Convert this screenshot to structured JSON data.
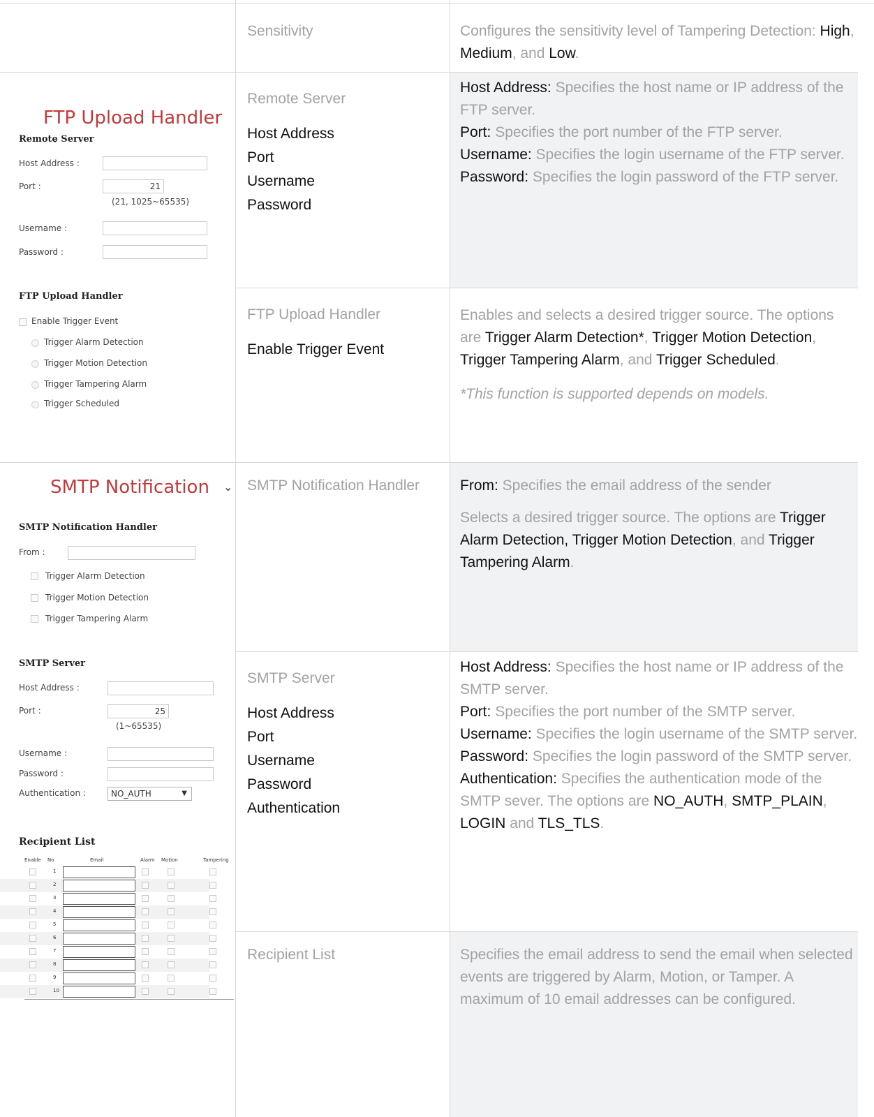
{
  "sensitivity": {
    "name": "Sensitivity",
    "desc_prefix": "Configures the sensitivity level of Tampering Detection: ",
    "high": "High",
    "sep1": ", ",
    "medium": "Medium",
    "sep2": ", and ",
    "low": "Low",
    "end": "."
  },
  "ftp_shot": {
    "header": "FTP Upload Handler",
    "chevron": "⌄",
    "remote_server_title": "Remote Server",
    "host_label": "Host Address :",
    "host_value": "",
    "port_label": "Port :",
    "port_value": "21",
    "port_hint": "(21, 1025~65535)",
    "username_label": "Username :",
    "password_label": "Password :",
    "handler_title": "FTP Upload Handler",
    "enable_trigger": "Enable Trigger Event",
    "options": [
      "Trigger Alarm Detection",
      "Trigger Motion Detection",
      "Trigger Tampering Alarm",
      "Trigger Scheduled"
    ]
  },
  "remote_server": {
    "category": "Remote Server",
    "fields": [
      "Host Address",
      "Port",
      "Username",
      "Password"
    ],
    "host_k": "Host Address:",
    "host_d": " Specifies the host name or IP address of the FTP server.",
    "port_k": "Port:",
    "port_d": " Specifies the port number of the FTP server.",
    "user_k": "Username:",
    "user_d": " Specifies the login username of the FTP server.",
    "pass_k": "Password:",
    "pass_d": " Specifies the login password of the FTP server."
  },
  "ftp_handler": {
    "category": "FTP Upload Handler",
    "field": "Enable Trigger Event",
    "d1": "Enables and selects a desired trigger source. The options are ",
    "o1": "Trigger Alarm Detection*",
    "s1": ", ",
    "o2": "Trigger Motion Detection",
    "s2": ", ",
    "o3": "Trigger Tampering Alarm",
    "s3": ", and ",
    "o4": "Trigger Scheduled",
    "s4": ".",
    "note": "*This function is supported depends on models."
  },
  "smtp_shot": {
    "header": "SMTP Notification",
    "chevron": "⌄",
    "handler_title": "SMTP Notification Handler",
    "from_label": "From :",
    "options": [
      "Trigger Alarm Detection",
      "Trigger Motion Detection",
      "Trigger Tampering Alarm"
    ],
    "server_title": "SMTP Server",
    "host_label": "Host Address :",
    "port_label": "Port :",
    "port_value": "25",
    "port_hint": "(1~65535)",
    "username_label": "Username :",
    "password_label": "Password :",
    "auth_label": "Authentication :",
    "auth_value": "NO_AUTH",
    "recipient_title": "Recipient List",
    "rl_cols": [
      "Enable",
      "No",
      "Email",
      "Alarm",
      "Motion",
      "Tampering"
    ],
    "rl_numbers": [
      "1",
      "2",
      "3",
      "4",
      "5",
      "6",
      "7",
      "8",
      "9",
      "10"
    ]
  },
  "smtp_handler": {
    "category": "SMTP Notification Handler",
    "from_k": "From:",
    "from_d": " Specifies the email address of the sender",
    "d1": "Selects a desired trigger source. The options are ",
    "o1": "Trigger Alarm Detection, Trigger Motion Detection",
    "s1": ", and ",
    "o2": "Trigger Tampering Alarm",
    "s2": "."
  },
  "smtp_server": {
    "category": "SMTP Server",
    "fields": [
      "Host Address",
      "Port",
      "Username",
      "Password",
      "Authentication"
    ],
    "host_k": "Host Address:",
    "host_d": " Specifies the host name or IP address of the SMTP server.",
    "port_k": "Port:",
    "port_d": " Specifies the port number of the SMTP server.",
    "user_k": "Username:",
    "user_d": " Specifies the login username of the SMTP server.",
    "pass_k": "Password:",
    "pass_d": " Specifies the login password of the SMTP server.",
    "auth_k": "Authentication:",
    "auth_d": " Specifies the authentication mode of the SMTP sever. The options are ",
    "a1": "NO_AUTH",
    "as1": ", ",
    "a2": "SMTP_PLAIN",
    "as2": ", ",
    "a3": "LOGIN",
    "as3": " and ",
    "a4": "TLS_TLS",
    "as4": "."
  },
  "recipient_list": {
    "category": "Recipient List",
    "desc": "Specifies the email address to send the email when selected events are triggered by Alarm, Motion, or Tamper. A maximum of 10 email addresses can be configured."
  }
}
